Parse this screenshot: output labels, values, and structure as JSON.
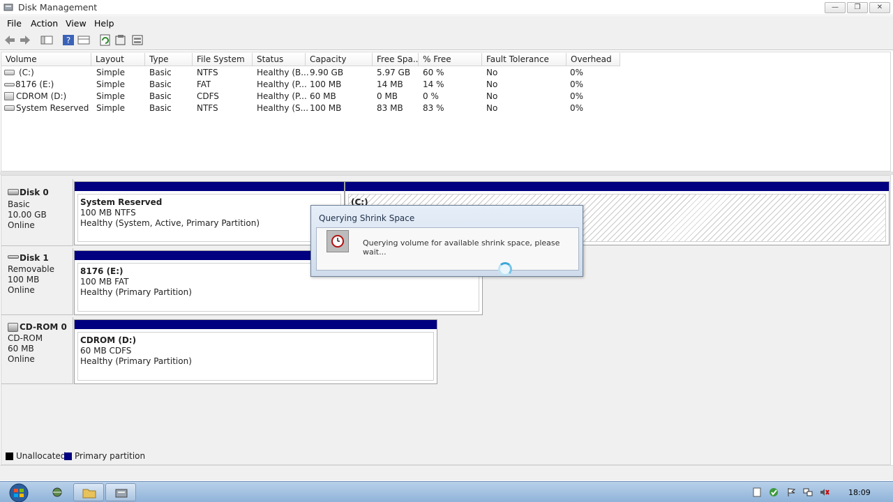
{
  "window": {
    "title": "Disk Management"
  },
  "menu": [
    "File",
    "Action",
    "View",
    "Help"
  ],
  "volume_list": {
    "columns": [
      "Volume",
      "Layout",
      "Type",
      "File System",
      "Status",
      "Capacity",
      "Free Spa...",
      "% Free",
      "Fault Tolerance",
      "Overhead"
    ],
    "rows": [
      [
        "(C:)",
        "Simple",
        "Basic",
        "NTFS",
        "Healthy (B...",
        "9.90 GB",
        "5.97 GB",
        "60 %",
        "No",
        "0%"
      ],
      [
        "8176 (E:)",
        "Simple",
        "Basic",
        "FAT",
        "Healthy (P...",
        "100 MB",
        "14 MB",
        "14 %",
        "No",
        "0%"
      ],
      [
        "CDROM (D:)",
        "Simple",
        "Basic",
        "CDFS",
        "Healthy (P...",
        "60 MB",
        "0 MB",
        "0 %",
        "No",
        "0%"
      ],
      [
        "System Reserved",
        "Simple",
        "Basic",
        "NTFS",
        "Healthy (S...",
        "100 MB",
        "83 MB",
        "83 %",
        "No",
        "0%"
      ]
    ]
  },
  "disks": [
    {
      "name": "Disk 0",
      "type": "Basic",
      "size": "10.00 GB",
      "status": "Online",
      "partitions": [
        {
          "name": "System Reserved",
          "detail": "100 MB NTFS",
          "health": "Healthy (System, Active, Primary Partition)"
        },
        {
          "name": "(C:)",
          "detail": "",
          "health": ""
        }
      ]
    },
    {
      "name": "Disk 1",
      "type": "Removable",
      "size": "100 MB",
      "status": "Online",
      "partitions": [
        {
          "name": "8176  (E:)",
          "detail": "100 MB FAT",
          "health": "Healthy (Primary Partition)"
        }
      ]
    },
    {
      "name": "CD-ROM 0",
      "type": "CD-ROM",
      "size": "60 MB",
      "status": "Online",
      "partitions": [
        {
          "name": "CDROM  (D:)",
          "detail": "60 MB CDFS",
          "health": "Healthy (Primary Partition)"
        }
      ]
    }
  ],
  "legend": [
    {
      "label": "Unallocated",
      "color": "#000000"
    },
    {
      "label": "Primary partition",
      "color": "#000080"
    }
  ],
  "dialog": {
    "title": "Querying Shrink Space",
    "message": "Querying volume for available shrink space, please wait..."
  },
  "taskbar": {
    "clock": "18:09",
    "icons": [
      "start-orb-icon",
      "network-map-icon",
      "windows-explorer-icon",
      "disk-management-icon"
    ]
  },
  "colors": {
    "primary_partition": "#000080",
    "unallocated": "#000000"
  }
}
